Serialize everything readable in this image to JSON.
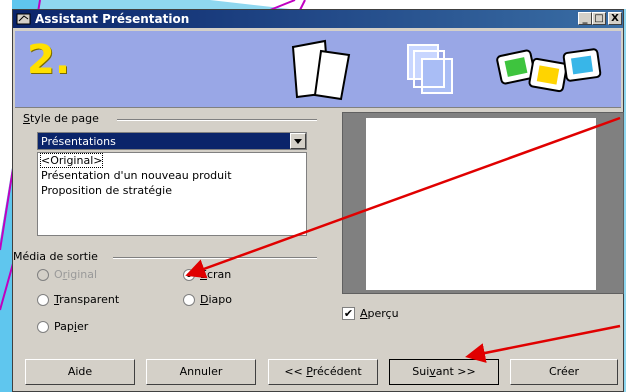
{
  "window": {
    "title": "Assistant Présentation"
  },
  "caption_buttons": {
    "minimize": "_",
    "maximize": "□",
    "close": "X"
  },
  "banner": {
    "step": "2."
  },
  "style": {
    "label_pre": "",
    "label_ul": "S",
    "label_post": "tyle de page",
    "selected": "Présentations",
    "items": [
      "<Original>",
      "Présentation d'un nouveau produit",
      "Proposition de stratégie"
    ]
  },
  "output": {
    "label": "Média de sortie",
    "original": {
      "pre": "O",
      "ul": "r",
      "post": "iginal"
    },
    "transparent": {
      "pre": "",
      "ul": "T",
      "post": "ransparent"
    },
    "papier": {
      "pre": "Pap",
      "ul": "i",
      "post": "er"
    },
    "ecran": {
      "pre": "",
      "ul": "E",
      "post": "cran"
    },
    "diapo": {
      "pre": "",
      "ul": "D",
      "post": "iapo"
    }
  },
  "preview": {
    "pre": "",
    "ul": "A",
    "post": "perçu",
    "check": "✔"
  },
  "buttons": {
    "help": "Aide",
    "cancel": "Annuler",
    "back": {
      "pre": "<< ",
      "ul": "P",
      "post": "récédent"
    },
    "next": {
      "pre": "Sui",
      "ul": "v",
      "post": "ant >>"
    },
    "create": "Créer"
  },
  "colors": {
    "banner": "#99a7e6",
    "titlebar": "#0a246a",
    "arrow": "#e00000",
    "step": "#ffe000"
  }
}
